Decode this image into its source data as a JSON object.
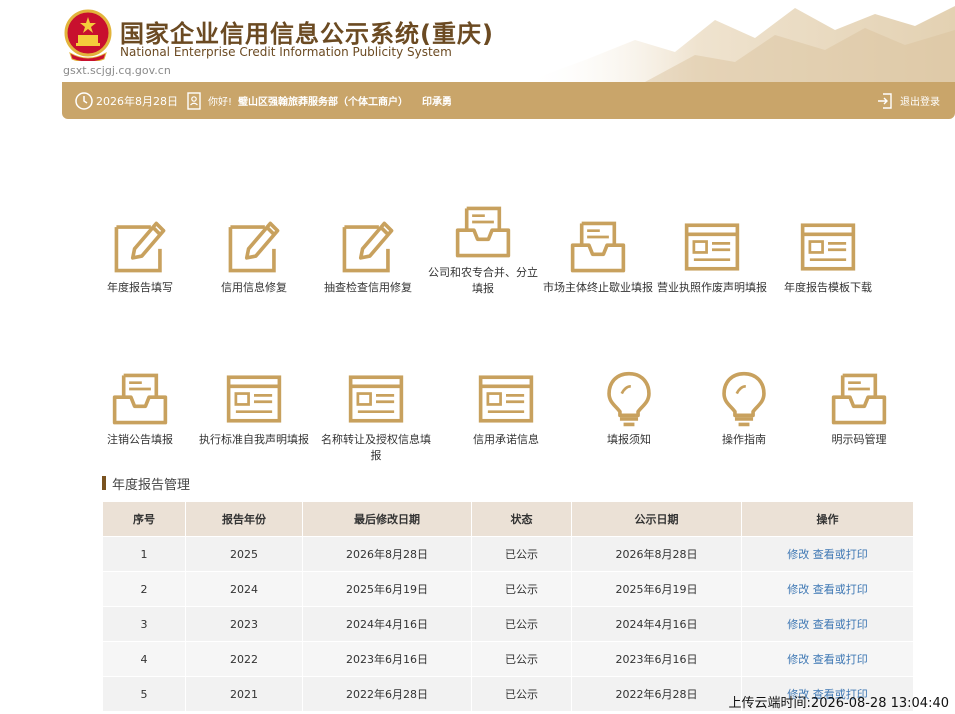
{
  "header": {
    "title_cn": "国家企业信用信息公示系统(重庆)",
    "title_en": "National Enterprise Credit Information Publicity System",
    "domain": "gsxt.scjgj.cq.gov.cn"
  },
  "bar": {
    "date": "2026年8月28日",
    "greeting": "你好!",
    "company": "璧山区强翰旅莽服务部（个体工商户）",
    "person": "印承勇",
    "logout": "退出登录"
  },
  "functions_row1": [
    {
      "label": "年度报告填写",
      "icon": "pencil-icon"
    },
    {
      "label": "信用信息修复",
      "icon": "pencil-icon"
    },
    {
      "label": "抽查检查信用修复",
      "icon": "pencil-icon"
    },
    {
      "label": "公司和农专合并、分立填报",
      "icon": "inbox-icon"
    },
    {
      "label": "市场主体终止歇业填报",
      "icon": "inbox-icon"
    },
    {
      "label": "营业执照作废声明填报",
      "icon": "form-icon"
    },
    {
      "label": "年度报告模板下载",
      "icon": "form-icon"
    }
  ],
  "functions_row2": [
    {
      "label": "注销公告填报",
      "icon": "inbox-icon"
    },
    {
      "label": "执行标准自我声明填报",
      "icon": "form-icon"
    },
    {
      "label": "名称转让及授权信息填报",
      "icon": "form-icon"
    },
    {
      "label": "信用承诺信息",
      "icon": "form-icon"
    },
    {
      "label": "填报须知",
      "icon": "lightbulb-icon"
    },
    {
      "label": "操作指南",
      "icon": "lightbulb-icon"
    },
    {
      "label": "明示码管理",
      "icon": "inbox-icon"
    }
  ],
  "section": {
    "title": "年度报告管理"
  },
  "table": {
    "columns": [
      "序号",
      "报告年份",
      "最后修改日期",
      "状态",
      "公示日期",
      "操作"
    ],
    "rows": [
      {
        "no": "1",
        "year": "2025",
        "modified": "2026年8月28日",
        "status": "已公示",
        "published": "2026年8月28日",
        "edit": "修改",
        "view": "查看或打印"
      },
      {
        "no": "2",
        "year": "2024",
        "modified": "2025年6月19日",
        "status": "已公示",
        "published": "2025年6月19日",
        "edit": "修改",
        "view": "查看或打印"
      },
      {
        "no": "3",
        "year": "2023",
        "modified": "2024年4月16日",
        "status": "已公示",
        "published": "2024年4月16日",
        "edit": "修改",
        "view": "查看或打印"
      },
      {
        "no": "4",
        "year": "2022",
        "modified": "2023年6月16日",
        "status": "已公示",
        "published": "2023年6月16日",
        "edit": "修改",
        "view": "查看或打印"
      },
      {
        "no": "5",
        "year": "2021",
        "modified": "2022年6月28日",
        "status": "已公示",
        "published": "2022年6月28日",
        "edit": "修改",
        "view": "查看或打印"
      }
    ]
  },
  "footer": {
    "timestamp": "上传云端时间:2026-08-28 13:04:40"
  },
  "colors": {
    "gold": "#c9a56a",
    "icon_gold": "#c8a15e",
    "brown": "#6b4a22",
    "link": "#3f78b4"
  }
}
